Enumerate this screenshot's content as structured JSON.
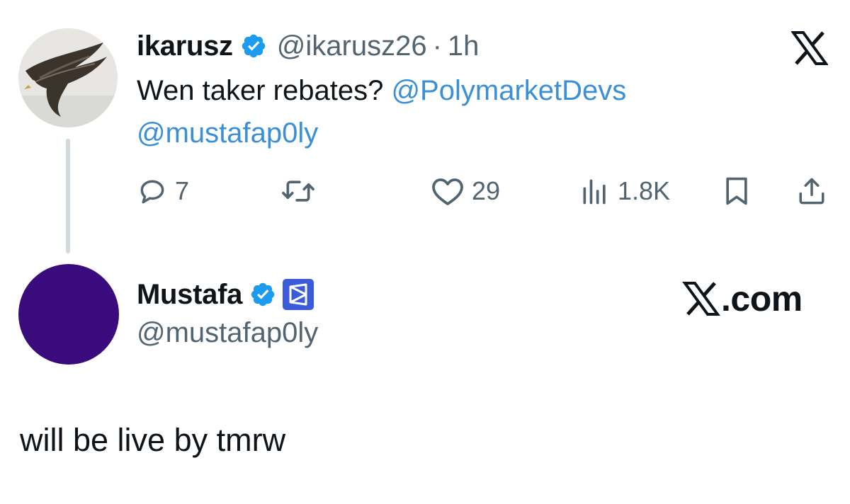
{
  "parent_tweet": {
    "author_name": "ikarusz",
    "author_handle": "@ikarusz26",
    "separator": "·",
    "time": "1h",
    "text_prefix": "Wen taker rebates? ",
    "mention_1": "@PolymarketDevs",
    "mention_2": "@mustafap0ly",
    "actions": {
      "reply_count": "7",
      "repost_count": "",
      "like_count": "29",
      "view_count": "1.8K"
    }
  },
  "reply_tweet": {
    "author_name": "Mustafa",
    "author_handle": "@mustafap0ly",
    "text": "will be live by tmrw",
    "avatar_color": "#3a0b7c"
  },
  "branding": {
    "x_com_text": ".com"
  },
  "colors": {
    "verified": "#1d9bf0",
    "mention": "#3b8fd6",
    "muted": "#536471",
    "affiliate_badge": "#3b5bdb"
  },
  "icons": {
    "verified": "verified-badge-icon",
    "affiliate": "polymarket-affiliate-icon",
    "x_logo": "x-logo-icon",
    "reply": "reply-icon",
    "repost": "repost-icon",
    "like": "heart-icon",
    "views": "views-chart-icon",
    "bookmark": "bookmark-icon",
    "share": "share-icon"
  }
}
